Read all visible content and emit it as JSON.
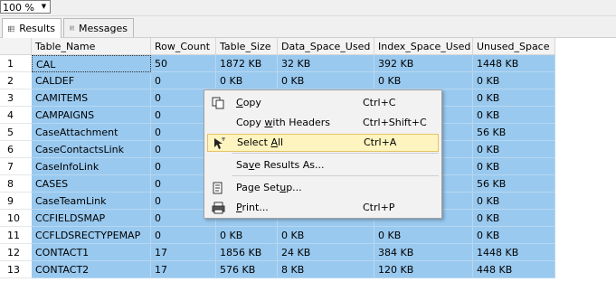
{
  "zoom": {
    "value": "100 %"
  },
  "tabs": [
    {
      "label": "Results",
      "icon": "grid-icon",
      "active": true
    },
    {
      "label": "Messages",
      "icon": "messages-icon",
      "active": false
    }
  ],
  "grid": {
    "columns": [
      "Table_Name",
      "Row_Count",
      "Table_Size",
      "Data_Space_Used",
      "Index_Space_Used",
      "Unused_Space"
    ],
    "rows": [
      {
        "n": "1",
        "cells": [
          "CAL",
          "50",
          "1872 KB",
          "32 KB",
          "392 KB",
          "1448 KB"
        ]
      },
      {
        "n": "2",
        "cells": [
          "CALDEF",
          "0",
          "0 KB",
          "0 KB",
          "0 KB",
          "0 KB"
        ]
      },
      {
        "n": "3",
        "cells": [
          "CAMITEMS",
          "0",
          "",
          "",
          "",
          "0 KB"
        ]
      },
      {
        "n": "4",
        "cells": [
          "CAMPAIGNS",
          "0",
          "",
          "",
          "",
          "0 KB"
        ]
      },
      {
        "n": "5",
        "cells": [
          "CaseAttachment",
          "0",
          "",
          "",
          "",
          "56 KB"
        ]
      },
      {
        "n": "6",
        "cells": [
          "CaseContactsLink",
          "0",
          "",
          "",
          "",
          "0 KB"
        ]
      },
      {
        "n": "7",
        "cells": [
          "CaseInfoLink",
          "0",
          "",
          "",
          "",
          "0 KB"
        ]
      },
      {
        "n": "8",
        "cells": [
          "CASES",
          "0",
          "",
          "",
          "",
          "56 KB"
        ]
      },
      {
        "n": "9",
        "cells": [
          "CaseTeamLink",
          "0",
          "",
          "",
          "",
          "0 KB"
        ]
      },
      {
        "n": "10",
        "cells": [
          "CCFIELDSMAP",
          "0",
          "",
          "",
          "",
          "0 KB"
        ]
      },
      {
        "n": "11",
        "cells": [
          "CCFLDSRECTYPEMAP",
          "0",
          "0 KB",
          "0 KB",
          "0 KB",
          "0 KB"
        ]
      },
      {
        "n": "12",
        "cells": [
          "CONTACT1",
          "17",
          "1856 KB",
          "24 KB",
          "384 KB",
          "1448 KB"
        ]
      },
      {
        "n": "13",
        "cells": [
          "CONTACT2",
          "17",
          "576 KB",
          "8 KB",
          "120 KB",
          "448 KB"
        ]
      }
    ]
  },
  "context_menu": {
    "items": [
      {
        "pre": "",
        "ul": "C",
        "post": "opy",
        "shortcut": "Ctrl+C",
        "icon": "copy-icon"
      },
      {
        "pre": "Copy ",
        "ul": "w",
        "post": "ith Headers",
        "shortcut": "Ctrl+Shift+C",
        "icon": ""
      },
      {
        "pre": "Select ",
        "ul": "A",
        "post": "ll",
        "shortcut": "Ctrl+A",
        "icon": "select-all-icon"
      },
      {
        "pre": "Sa",
        "ul": "v",
        "post": "e Results As...",
        "shortcut": "",
        "icon": ""
      },
      {
        "pre": "Page Set",
        "ul": "u",
        "post": "p...",
        "shortcut": "",
        "icon": "page-setup-icon"
      },
      {
        "pre": "",
        "ul": "P",
        "post": "rint...",
        "shortcut": "Ctrl+P",
        "icon": "print-icon"
      }
    ]
  },
  "colors": {
    "selection": "#99c9ef",
    "menu_highlight": "#fdf4bf",
    "header": "#f3f3f3"
  }
}
